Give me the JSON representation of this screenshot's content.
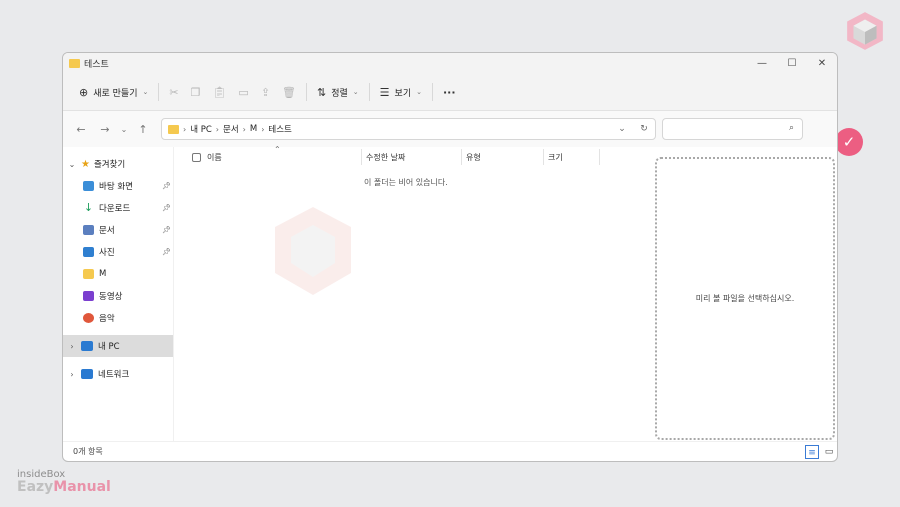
{
  "window": {
    "title": "테스트"
  },
  "toolbar": {
    "new_label": "새로 만들기",
    "sort_label": "정렬",
    "view_label": "보기",
    "more": "···"
  },
  "address": {
    "crumbs": [
      "내 PC",
      "문서",
      "M",
      "테스트"
    ],
    "search_placeholder": ""
  },
  "sidebar": {
    "quick_access": "즐겨찾기",
    "items": [
      {
        "label": "바탕 화면",
        "pinned": true,
        "color": "#3b8ed8"
      },
      {
        "label": "다운로드",
        "pinned": true,
        "color": "#1f9e5e"
      },
      {
        "label": "문서",
        "pinned": true,
        "color": "#5b7fbf"
      },
      {
        "label": "사진",
        "pinned": true,
        "color": "#2f7fd0"
      },
      {
        "label": "M",
        "pinned": false,
        "color": "#f5c94f"
      },
      {
        "label": "동영상",
        "pinned": false,
        "color": "#7b3fcf"
      },
      {
        "label": "음악",
        "pinned": false,
        "color": "#e0573b"
      }
    ],
    "this_pc": "내 PC",
    "network": "네트워크"
  },
  "columns": {
    "name": "이름",
    "modified": "수정한 날짜",
    "type": "유형",
    "size": "크기"
  },
  "list": {
    "empty_message": "이 폴더는 비어 있습니다."
  },
  "preview": {
    "message": "미리 볼 파일을 선택하십시오."
  },
  "status": {
    "count": "0개 항목"
  },
  "branding": {
    "line1": "insideBox",
    "line2_a": "Eazy",
    "line2_b": "Manual"
  }
}
